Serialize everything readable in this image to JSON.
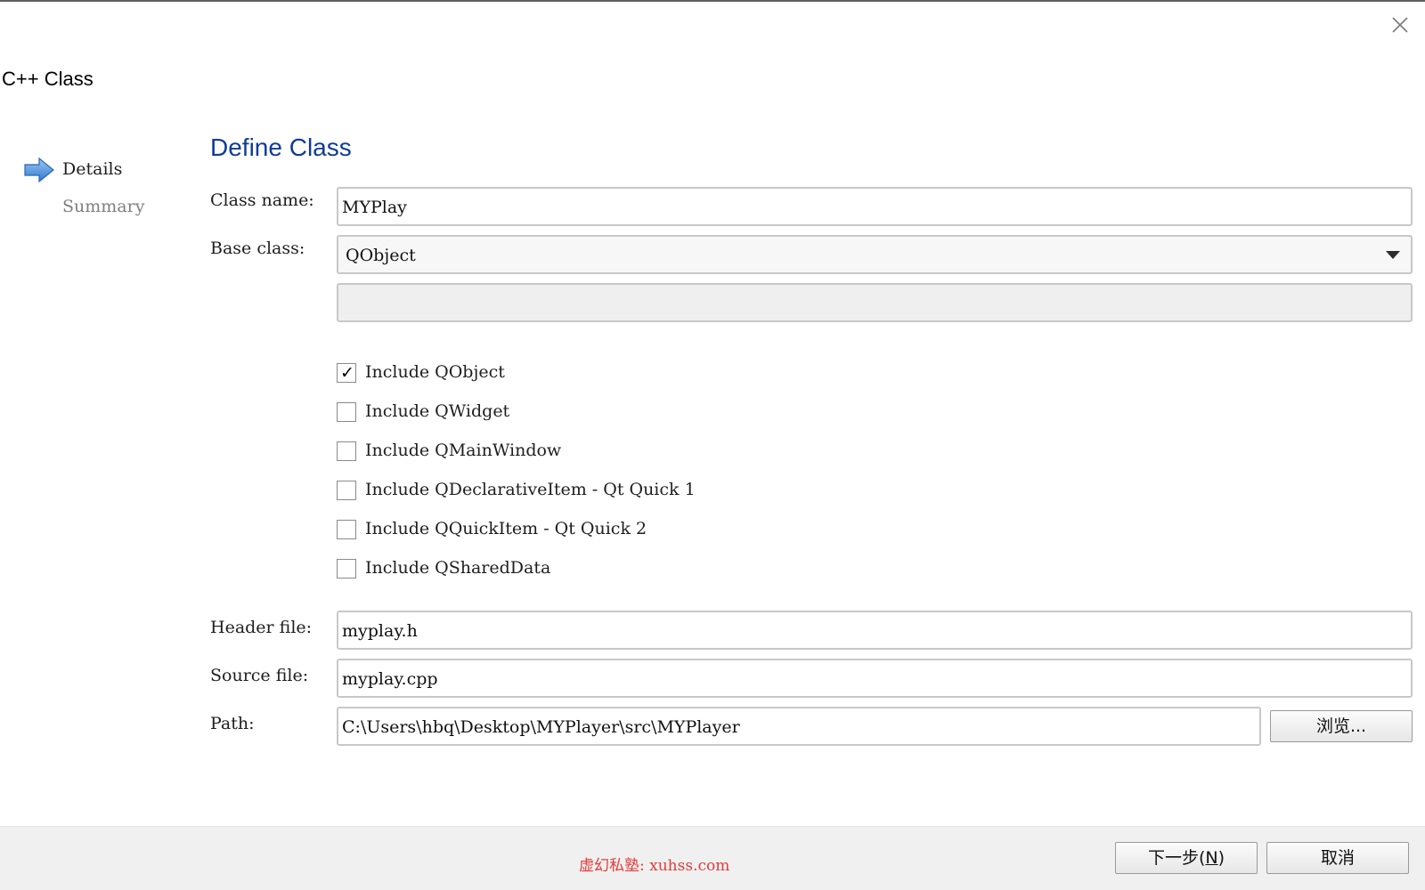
{
  "window": {
    "title": "C++ Class",
    "close_icon": "close-icon"
  },
  "steps": [
    {
      "label": "Details",
      "active": true,
      "icon": "arrow-right-icon"
    },
    {
      "label": "Summary",
      "active": false
    }
  ],
  "page": {
    "heading": "Define Class"
  },
  "form": {
    "class_name_label": "Class name:",
    "class_name_value": "MYPlay",
    "base_class_label": "Base class:",
    "base_class_value": "QObject",
    "extra_field_value": "",
    "header_file_label": "Header file:",
    "header_file_value": "myplay.h",
    "source_file_label": "Source file:",
    "source_file_value": "myplay.cpp",
    "path_label": "Path:",
    "path_value": "C:\\Users\\hbq\\Desktop\\MYPlayer\\src\\MYPlayer",
    "browse_label": "浏览..."
  },
  "checkboxes": [
    {
      "label": "Include QObject",
      "checked": true
    },
    {
      "label": "Include QWidget",
      "checked": false
    },
    {
      "label": "Include QMainWindow",
      "checked": false
    },
    {
      "label": "Include QDeclarativeItem - Qt Quick 1",
      "checked": false
    },
    {
      "label": "Include QQuickItem - Qt Quick 2",
      "checked": false
    },
    {
      "label": "Include QSharedData",
      "checked": false
    }
  ],
  "footer": {
    "next_label": "下一步(",
    "next_mnemonic": "N",
    "next_close": ")",
    "cancel_label": "取消",
    "watermark": "虚幻私塾: xuhss.com"
  },
  "colors": {
    "heading": "#0f3c97",
    "watermark": "#e33b3b",
    "step_arrow": "#3d8bd9"
  }
}
